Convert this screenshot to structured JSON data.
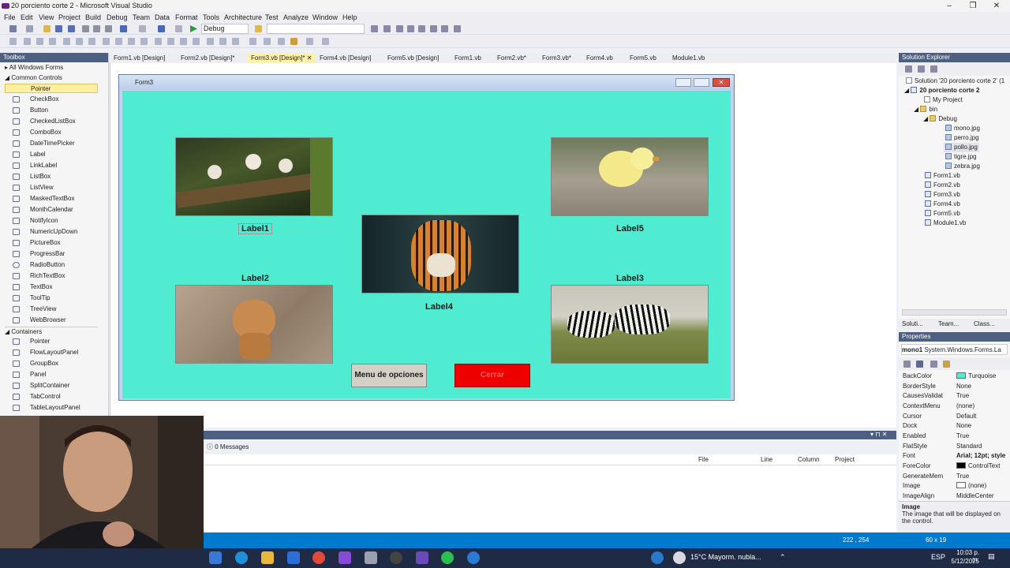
{
  "window": {
    "title": "20 porciento corte 2 - Microsoft Visual Studio"
  },
  "menu": [
    "File",
    "Edit",
    "View",
    "Project",
    "Build",
    "Debug",
    "Team",
    "Data",
    "Format",
    "Tools",
    "Architecture",
    "Test",
    "Analyze",
    "Window",
    "Help"
  ],
  "toolbar": {
    "config": "Debug"
  },
  "toolbox": {
    "title": "Toolbox",
    "all_forms": "All Windows Forms",
    "common": "Common Controls",
    "items": [
      "Pointer",
      "CheckBox",
      "Button",
      "CheckedListBox",
      "ComboBox",
      "DateTimePicker",
      "Label",
      "LinkLabel",
      "ListBox",
      "ListView",
      "MaskedTextBox",
      "MonthCalendar",
      "NotifyIcon",
      "NumericUpDown",
      "PictureBox",
      "ProgressBar",
      "RadioButton",
      "RichTextBox",
      "TextBox",
      "ToolTip",
      "TreeView",
      "WebBrowser"
    ],
    "containers": "Containers",
    "container_items": [
      "Pointer",
      "FlowLayoutPanel",
      "GroupBox",
      "Panel",
      "SplitContainer",
      "TabControl",
      "TableLayoutPanel"
    ]
  },
  "tabs": [
    "Form1.vb [Design]",
    "Form2.vb [Design]*",
    "Form3.vb [Design]*",
    "Form4.vb [Design]",
    "Form5.vb [Design]",
    "Form1.vb",
    "Form2.vb*",
    "Form3.vb*",
    "Form4.vb",
    "Form5.vb",
    "Module1.vb"
  ],
  "form": {
    "title": "Form3",
    "labels": {
      "l1": "Label1",
      "l2": "Label2",
      "l3": "Label3",
      "l4": "Label4",
      "l5": "Label5"
    },
    "btn_menu": "Menu de opciones",
    "btn_close": "Cerrar",
    "backcolor": "#4fecd2",
    "close_color": "#ee0000"
  },
  "solution": {
    "title": "Solution Explorer",
    "root": "Solution '20 porciento corte 2' (1",
    "project": "20 porciento corte 2",
    "items": [
      "My Project",
      "bin",
      "Debug",
      "mono.jpg",
      "perro.jpg",
      "pollo.jpg",
      "tigre.jpg",
      "zebra.jpg",
      "Form1.vb",
      "Form2.vb",
      "Form3.vb",
      "Form4.vb",
      "Form5.vb",
      "Module1.vb"
    ],
    "tabs": [
      "Soluti...",
      "Team...",
      "Class..."
    ]
  },
  "properties": {
    "title": "Properties",
    "object": "mono1",
    "type": "System.Windows.Forms.La",
    "rows": [
      {
        "name": "BackColor",
        "value": "Turquoise"
      },
      {
        "name": "BorderStyle",
        "value": "None"
      },
      {
        "name": "CausesValidat",
        "value": "True"
      },
      {
        "name": "ContextMenu",
        "value": "(none)"
      },
      {
        "name": "Cursor",
        "value": "Default"
      },
      {
        "name": "Dock",
        "value": "None"
      },
      {
        "name": "Enabled",
        "value": "True"
      },
      {
        "name": "FlatStyle",
        "value": "Standard"
      },
      {
        "name": "Font",
        "value": "Arial; 12pt; style"
      },
      {
        "name": "ForeColor",
        "value": "ControlText"
      },
      {
        "name": "GenerateMem",
        "value": "True"
      },
      {
        "name": "Image",
        "value": "(none)"
      },
      {
        "name": "ImageAlign",
        "value": "MiddleCenter"
      }
    ],
    "desc_title": "Image",
    "desc_text": "The image that will be displayed on the control."
  },
  "output": {
    "messages": "0 Messages",
    "cols": [
      "File",
      "Line",
      "Column",
      "Project"
    ]
  },
  "status": {
    "pos": "222 , 254",
    "size": "60 x 19"
  },
  "taskbar": {
    "weather": "15°C  Mayorm. nubla...",
    "lang": "ESP",
    "time": "10:03 p. m.",
    "date": "5/12/2025"
  }
}
